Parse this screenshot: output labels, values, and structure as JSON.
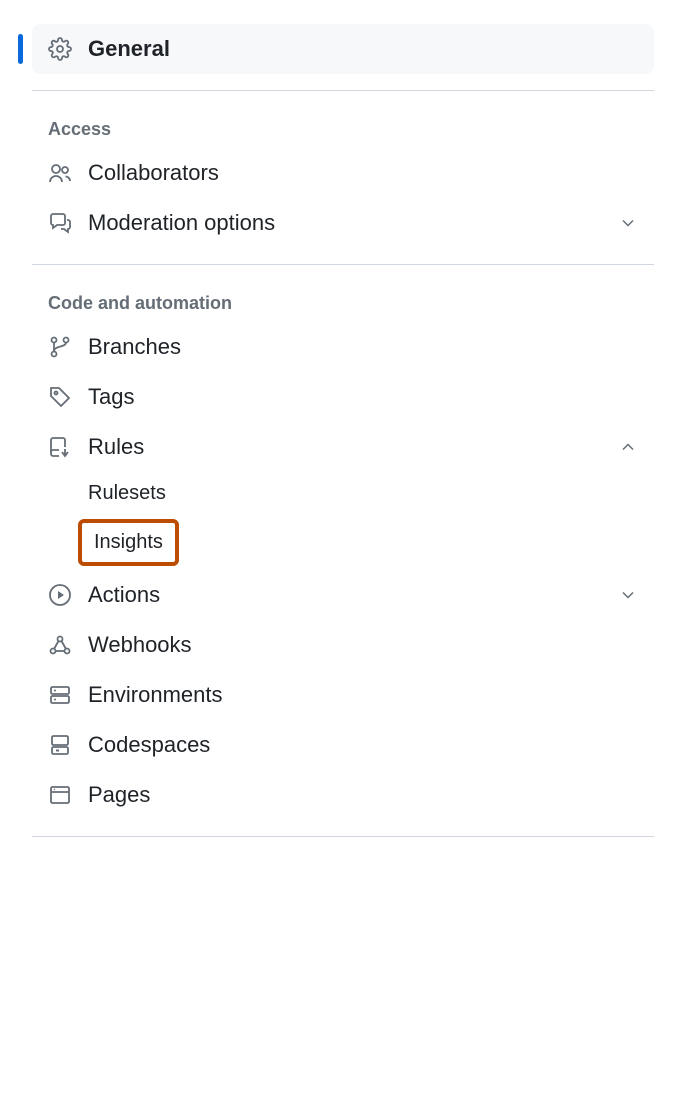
{
  "sidebar": {
    "general": {
      "label": "General"
    },
    "sections": {
      "access": {
        "header": "Access",
        "collaborators": {
          "label": "Collaborators"
        },
        "moderation": {
          "label": "Moderation options"
        }
      },
      "code": {
        "header": "Code and automation",
        "branches": {
          "label": "Branches"
        },
        "tags": {
          "label": "Tags"
        },
        "rules": {
          "label": "Rules",
          "rulesets": {
            "label": "Rulesets"
          },
          "insights": {
            "label": "Insights"
          }
        },
        "actions": {
          "label": "Actions"
        },
        "webhooks": {
          "label": "Webhooks"
        },
        "environments": {
          "label": "Environments"
        },
        "codespaces": {
          "label": "Codespaces"
        },
        "pages": {
          "label": "Pages"
        }
      }
    }
  }
}
